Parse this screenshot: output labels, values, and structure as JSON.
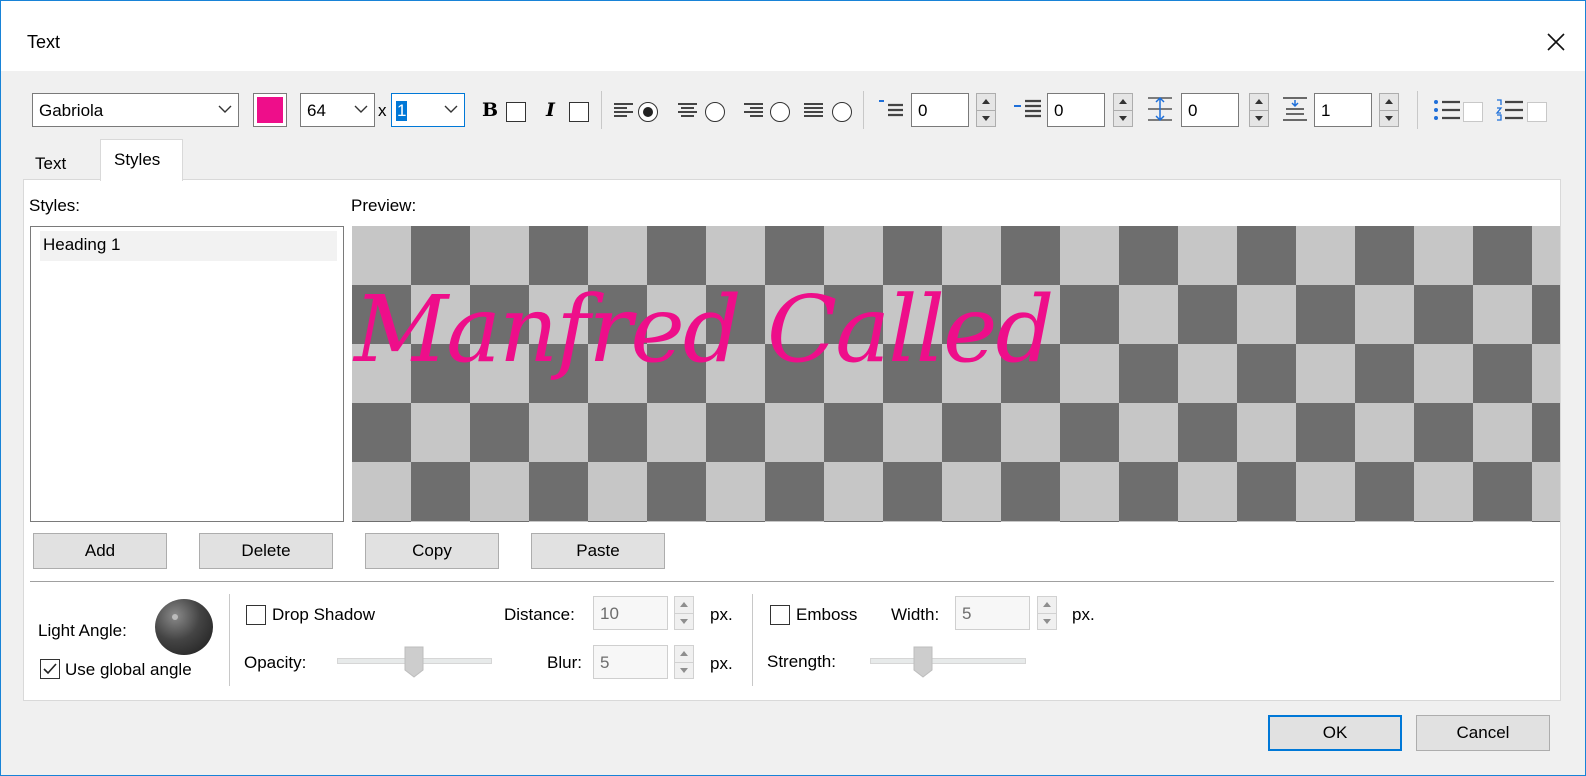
{
  "window": {
    "title": "Text"
  },
  "toolbar": {
    "font": "Gabriola",
    "color": "#ee0e8a",
    "size": "64",
    "times": "x",
    "scale": "1",
    "bold_label": "B",
    "italic_label": "I",
    "align_selected": "left",
    "first_indent": "0",
    "left_indent": "0",
    "space_before": "0",
    "line_spacing": "1"
  },
  "tabs": [
    {
      "label": "Text",
      "active": false
    },
    {
      "label": "Styles",
      "active": true
    }
  ],
  "styles": {
    "label": "Styles:",
    "items": [
      "Heading 1"
    ],
    "selected": 0
  },
  "preview": {
    "label": "Preview:",
    "text": "Manfred Called",
    "text_color": "#ee0e8a",
    "checker_dark": "#6e6e6e",
    "checker_light": "#c6c6c6"
  },
  "buttons": {
    "add": "Add",
    "delete": "Delete",
    "copy": "Copy",
    "paste": "Paste",
    "ok": "OK",
    "cancel": "Cancel"
  },
  "effects": {
    "light_angle_label": "Light Angle:",
    "use_global_angle_label": "Use global angle",
    "use_global_angle_checked": true,
    "drop_shadow_label": "Drop Shadow",
    "drop_shadow_checked": false,
    "distance_label": "Distance:",
    "distance_value": "10",
    "opacity_label": "Opacity:",
    "blur_label": "Blur:",
    "blur_value": "5",
    "px": "px.",
    "emboss_label": "Emboss",
    "emboss_checked": false,
    "width_label": "Width:",
    "width_value": "5",
    "strength_label": "Strength:"
  }
}
